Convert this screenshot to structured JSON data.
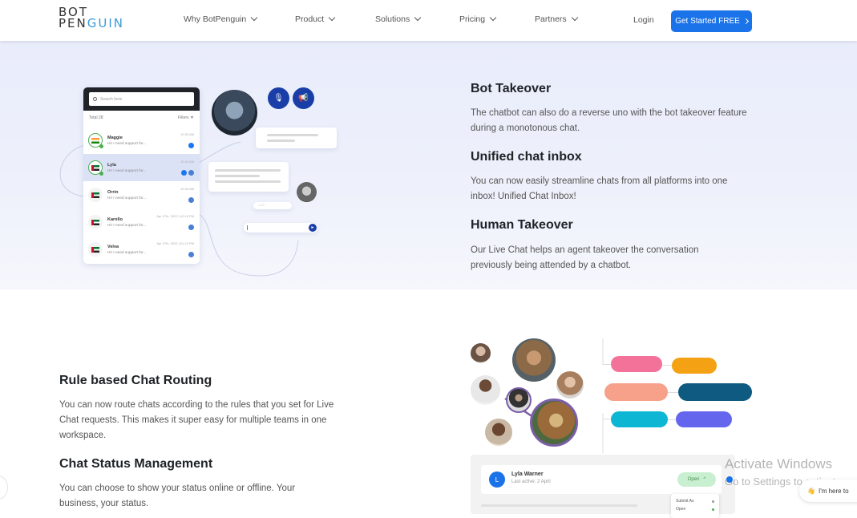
{
  "nav": {
    "logo_line1": "BOT",
    "logo_line2_a": "PEN",
    "logo_line2_b": "GUIN",
    "items": [
      {
        "label": "Why BotPenguin"
      },
      {
        "label": "Product"
      },
      {
        "label": "Solutions"
      },
      {
        "label": "Pricing"
      },
      {
        "label": "Partners"
      }
    ],
    "login": "Login",
    "cta": "Get Started FREE"
  },
  "chat_list": {
    "search_placeholder": "Search here",
    "total": "Total 28",
    "filters": "Filters",
    "rows": [
      {
        "name": "Maggie",
        "msg": "Hi! I need support for...",
        "time": "10:30 AM",
        "flag": "india",
        "channels": [
          "facebook"
        ],
        "online": true,
        "active": false
      },
      {
        "name": "Lyla",
        "msg": "Hi! I need support for...",
        "time": "10:30 AM",
        "flag": "uae",
        "channels": [
          "facebook",
          "web"
        ],
        "online": true,
        "active": true
      },
      {
        "name": "Orrin",
        "msg": "Hi! I need support for...",
        "time": "10:30 AM",
        "flag": "uae",
        "channels": [
          "web"
        ],
        "online": false,
        "active": false
      },
      {
        "name": "Karollo",
        "msg": "Hi! I need support for...",
        "time": "Apr 27th, 2022 | 12:15 PM",
        "flag": "uae",
        "channels": [
          "web"
        ],
        "online": false,
        "active": false
      },
      {
        "name": "Velva",
        "msg": "Hi! I need support for...",
        "time": "Apr 27th, 2022 | 01:13 PM",
        "flag": "uae",
        "channels": [
          "web"
        ],
        "online": false,
        "active": false
      }
    ]
  },
  "chat_preview": {
    "mic_icon": "🎙",
    "announce_icon": "📢",
    "typing_label": "1:15",
    "send_icon": "►"
  },
  "features_top": [
    {
      "title": "Bot Takeover",
      "body": "The chatbot can also do a reverse uno with the bot takeover feature during a monotonous chat."
    },
    {
      "title": "Unified chat inbox",
      "body": "You can now easily streamline chats from all platforms into one inbox! Unified Chat Inbox!"
    },
    {
      "title": "Human Takeover",
      "body": "Our Live Chat helps an agent takeover the conversation previously being attended by a chatbot."
    }
  ],
  "features_bottom": [
    {
      "title": "Rule based Chat Routing",
      "body": "You can now route chats according to the rules that you set for Live Chat requests. This makes it super easy for multiple teams in one workspace."
    },
    {
      "title": "Chat Status Management",
      "body": "You can choose to show your status online or offline. Your business, your status."
    }
  ],
  "routing_pills": {
    "colors": [
      "#f3729a",
      "#f4a114",
      "#f7a08a",
      "#0e5a80",
      "#0db6d3",
      "#6466ee"
    ]
  },
  "status_panel": {
    "avatar_letter": "L",
    "name": "Lyla Warner",
    "last_active": "Last active: 2 April",
    "status": "Open",
    "menu": [
      {
        "label": "Submit As",
        "color": "#999999"
      },
      {
        "label": "Open",
        "color": "#4caf50"
      }
    ]
  },
  "overlay": {
    "watermark_title": "Activate Windows",
    "watermark_sub": "Go to Settings to activate",
    "help_chip": "I'm here to",
    "help_icon": "👋"
  },
  "colors": {
    "brand_blue": "#1a73e8",
    "dark_blue": "#1a3ea8",
    "accent_purple": "#7b5ea7"
  }
}
